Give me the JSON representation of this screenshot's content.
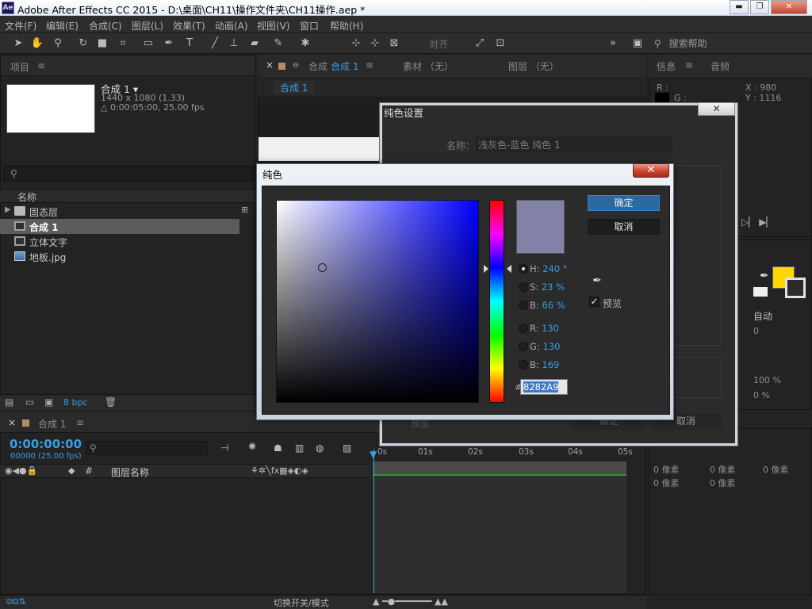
{
  "window": {
    "app_icon": "Ae",
    "title": "Adobe After Effects CC 2015 - D:\\桌面\\CH11\\操作文件夹\\CH11操作.aep *",
    "min": "▬",
    "max": "❐",
    "close": "✕"
  },
  "menu": [
    "文件(F)",
    "编辑(E)",
    "合成(C)",
    "图层(L)",
    "效果(T)",
    "动画(A)",
    "视图(V)",
    "窗口",
    "帮助(H)"
  ],
  "toolbar": {
    "align_label": "对齐",
    "search_help": "搜索帮助",
    "more": "»"
  },
  "project": {
    "tab": "项目",
    "menu_icon": "≡",
    "comp_name": "合成 1 ▾",
    "comp_size": "1440 x 1080 (1.33)",
    "comp_duration": "△ 0:00:05:00, 25.00 fps",
    "search_icon": "⚲",
    "col_name": "名称",
    "items": [
      {
        "label": "固态层",
        "type": "folder",
        "selected": false
      },
      {
        "label": "合成 1",
        "type": "comp",
        "selected": true
      },
      {
        "label": "立体文字",
        "type": "comp",
        "selected": false
      },
      {
        "label": "地板.jpg",
        "type": "image",
        "selected": false
      }
    ],
    "bpc": "8 bpc"
  },
  "comp_panel": {
    "close": "×",
    "lock": "🔓",
    "tab_prefix": "合成",
    "tab_name": "合成 1",
    "menu_icon": "≡",
    "footage_tab": "素材 （无）",
    "layer_tab": "图层 （无）",
    "subtab": "合成 1"
  },
  "info": {
    "tab": "信息",
    "audio_tab": "音频",
    "r": "R :",
    "g": "G :",
    "x": "X : 980",
    "y": "Y : 1116"
  },
  "char_panel": {
    "auto": "自动",
    "tracking": "0",
    "scale": "100 %",
    "baseline": "0 %",
    "playback": "▷▏ ▶▏"
  },
  "para_panel": {
    "indent_l": "0 像素",
    "indent_r": "0 像素",
    "indent_f": "0 像素",
    "space_b": "0 像素",
    "space_a": "0 像素"
  },
  "timeline": {
    "close": "×",
    "tab": "合成 1",
    "menu_icon": "≡",
    "timecode": "0:00:00:00",
    "frames": "00000 (25.00 fps)",
    "layer_col": "图层名称",
    "hash": "#",
    "ticks": [
      "0s",
      "01s",
      "02s",
      "03s",
      "04s",
      "05s"
    ],
    "toggle_mode": "切换开关/模式"
  },
  "solid_settings": {
    "title": "纯色设置",
    "name_label": "名称：",
    "name_value": "浅灰色-蓝色 纯色 1",
    "close": "✕",
    "preview_ghost": "预览",
    "ok_ghost": "确定",
    "cancel": "取消"
  },
  "color_picker": {
    "title": "纯色",
    "close": "✕",
    "hue_color": "#0000ff",
    "current_color": "#8282A9",
    "ok": "确定",
    "cancel": "取消",
    "preview": "预览",
    "check": "✓",
    "eyedropper": "✒",
    "hash": "#",
    "hex": "8282A9",
    "channels": [
      {
        "label": "H:",
        "value": "240 °",
        "selected": true
      },
      {
        "label": "S:",
        "value": "23 %",
        "selected": false
      },
      {
        "label": "B:",
        "value": "66 %",
        "selected": false
      },
      {
        "label": "R:",
        "value": "130",
        "selected": false
      },
      {
        "label": "G:",
        "value": "130",
        "selected": false
      },
      {
        "label": "B:",
        "value": "169",
        "selected": false
      }
    ]
  }
}
